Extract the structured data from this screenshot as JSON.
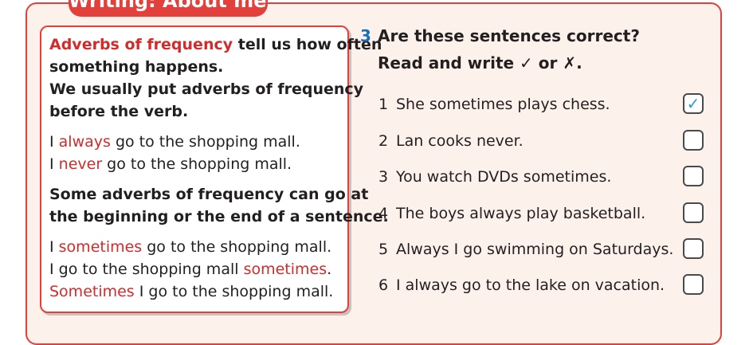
{
  "banner": {
    "title": "Writing: About me!"
  },
  "grammar": {
    "lines": [
      {
        "parts": [
          {
            "t": "Adverbs of frequency",
            "c": "red"
          },
          {
            "t": " tell us how often",
            "c": ""
          }
        ],
        "bold": true
      },
      {
        "parts": [
          {
            "t": "something happens.",
            "c": ""
          }
        ],
        "bold": true
      },
      {
        "parts": [
          {
            "t": "We usually put adverbs of frequency",
            "c": ""
          }
        ],
        "bold": true
      },
      {
        "parts": [
          {
            "t": "before the verb.",
            "c": ""
          }
        ],
        "bold": true
      },
      {
        "parts": [
          {
            "t": "I ",
            "c": ""
          },
          {
            "t": "always",
            "c": "red"
          },
          {
            "t": " go to the shopping mall.",
            "c": ""
          }
        ],
        "bold": false
      },
      {
        "parts": [
          {
            "t": "I ",
            "c": ""
          },
          {
            "t": "never",
            "c": "red"
          },
          {
            "t": " go to the shopping mall.",
            "c": ""
          }
        ],
        "bold": false
      },
      {
        "parts": [
          {
            "t": "Some adverbs of frequency can go at",
            "c": ""
          }
        ],
        "bold": true
      },
      {
        "parts": [
          {
            "t": "the beginning or the end of a sentence.",
            "c": ""
          }
        ],
        "bold": true
      },
      {
        "parts": [
          {
            "t": "I ",
            "c": ""
          },
          {
            "t": "sometimes",
            "c": "red"
          },
          {
            "t": " go to the shopping mall.",
            "c": ""
          }
        ],
        "bold": false
      },
      {
        "parts": [
          {
            "t": "I go to the shopping mall ",
            "c": ""
          },
          {
            "t": "sometimes",
            "c": "red"
          },
          {
            "t": ".",
            "c": ""
          }
        ],
        "bold": false
      },
      {
        "parts": [
          {
            "t": "Sometimes",
            "c": "red"
          },
          {
            "t": " I go to the shopping mall.",
            "c": ""
          }
        ],
        "bold": false
      }
    ]
  },
  "exercise": {
    "number": "3",
    "instruction_line1": "Are these sentences correct?",
    "instruction_line2": "Read and write ✓ or ✗.",
    "items": [
      {
        "num": "1",
        "text": "She sometimes plays chess.",
        "mark": "✓"
      },
      {
        "num": "2",
        "text": "Lan cooks never.",
        "mark": ""
      },
      {
        "num": "3",
        "text": "You watch DVDs sometimes.",
        "mark": ""
      },
      {
        "num": "4",
        "text": "The boys always play basketball.",
        "mark": ""
      },
      {
        "num": "5",
        "text": "Always I go swimming on Saturdays.",
        "mark": ""
      },
      {
        "num": "6",
        "text": "I always go to the lake on vacation.",
        "mark": ""
      }
    ]
  },
  "colors": {
    "accent_red": "#e3403b",
    "number_blue": "#1b6eb6",
    "tick_blue": "#2a9ad8"
  }
}
